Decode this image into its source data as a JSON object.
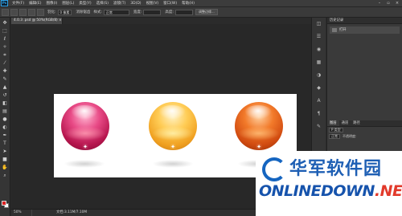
{
  "app": {
    "logo": "Ps"
  },
  "menu": {
    "items": [
      "文件(F)",
      "编辑(E)",
      "图像(I)",
      "图层(L)",
      "类型(Y)",
      "选择(S)",
      "滤镜(T)",
      "3D(D)",
      "视图(V)",
      "窗口(W)",
      "帮助(H)"
    ]
  },
  "window_controls": {
    "minimize": "–",
    "restore": "▫",
    "close": "×"
  },
  "options": {
    "feather_label": "羽化:",
    "feather_value": "0 像素",
    "antialias_label": "消除锯齿",
    "style_label": "样式:",
    "style_value": "正常",
    "width_label": "宽度:",
    "height_label": "高度:",
    "refine_edge": "调整边缘..."
  },
  "tools": {
    "icons": [
      "move-icon",
      "marquee-icon",
      "lasso-icon",
      "magic-wand-icon",
      "crop-icon",
      "eyedropper-icon",
      "healing-icon",
      "brush-icon",
      "stamp-icon",
      "history-brush-icon",
      "eraser-icon",
      "gradient-icon",
      "blur-icon",
      "dodge-icon",
      "pen-icon",
      "type-icon",
      "path-select-icon",
      "shape-icon",
      "hand-icon",
      "zoom-icon"
    ]
  },
  "document": {
    "tab_title": "4.0.3 .psd @ 50%(RGB/8) ×"
  },
  "status": {
    "zoom": "50%",
    "doc_size": "文档:3.11M/7.10M"
  },
  "panels": {
    "history_title": "历史记录",
    "history_item": "打开",
    "layers_tabs": [
      "图层",
      "通道",
      "路径"
    ],
    "layers_kind": "P 类型",
    "layers_blend": "正常",
    "layers_opacity_label": "不透明度:"
  },
  "watermark": {
    "chinese": "华军软件园",
    "english_prefix": "ONLINEDOWN",
    "english_suffix": ".NET"
  },
  "colors": {
    "sphere1": "#c8235a",
    "sphere2": "#f5a623",
    "sphere3": "#e0561a",
    "foreground": "#dd2222",
    "background": "#ffffff",
    "ps_blue": "#2fa3e8",
    "watermark_blue": "#1e5fb4"
  }
}
